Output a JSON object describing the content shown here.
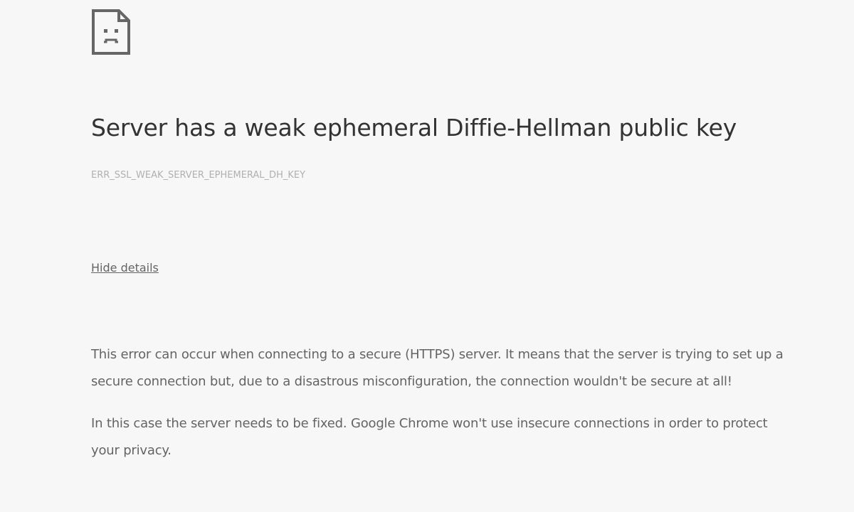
{
  "icon": {
    "name": "sad-page-icon"
  },
  "title": "Server has a weak ephemeral Diffie-Hellman public key",
  "error_code": "ERR_SSL_WEAK_SERVER_EPHEMERAL_DH_KEY",
  "details_link_label": "Hide details",
  "details": {
    "paragraphs": [
      "This error can occur when connecting to a secure (HTTPS) server. It means that the server is trying to set up a secure connection but, due to a disastrous misconfiguration, the connection wouldn't be secure at all!",
      "In this case the server needs to be fixed. Google Chrome won't use insecure connections in order to protect your privacy."
    ]
  },
  "colors": {
    "background": "#f7f7f7",
    "title": "#333333",
    "body_text": "#646464",
    "error_code": "#b0b0b0"
  }
}
